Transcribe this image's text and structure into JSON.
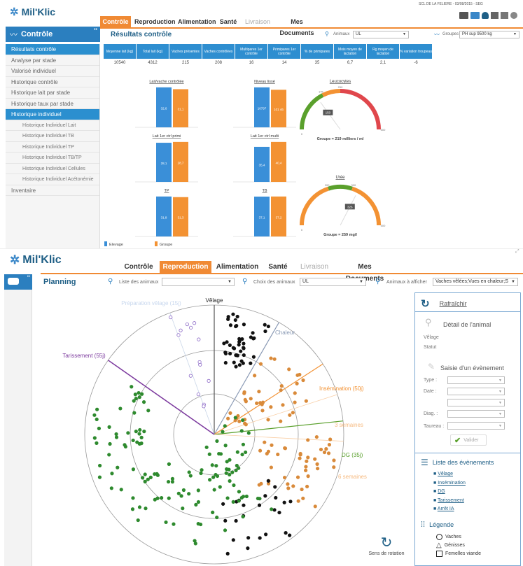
{
  "top": {
    "app_name": "Mil'Klic",
    "farm_info": "SCL DE LA FELIERE - 03/08/2015 - SEG",
    "tabs": [
      {
        "label": "Contrôle",
        "active": true
      },
      {
        "label": "Reproduction"
      },
      {
        "label": "Alimentation"
      },
      {
        "label": "Santé"
      },
      {
        "label": "Livraison",
        "disabled": true
      },
      {
        "label": "Mes Documents"
      }
    ],
    "sidebar_title": "Contrôle",
    "sidebar_items": [
      {
        "label": "Résultats contrôle",
        "active": true
      },
      {
        "label": "Analyse par stade"
      },
      {
        "label": "Valorisé individuel"
      },
      {
        "label": "Historique contrôle"
      },
      {
        "label": "Historique lait par stade"
      },
      {
        "label": "Historique taux par stade"
      },
      {
        "label": "Historique individuel",
        "active": true
      },
      {
        "label": "Historique Individuel Lait",
        "sub": true
      },
      {
        "label": "Historique Individuel TB",
        "sub": true
      },
      {
        "label": "Historique Individuel TP",
        "sub": true
      },
      {
        "label": "Historique Individuel TB/TP",
        "sub": true
      },
      {
        "label": "Historique Individuel Cellules",
        "sub": true
      },
      {
        "label": "Historique Individuel Acétonémie",
        "sub": true
      },
      {
        "label": "Inventaire"
      }
    ],
    "page_title": "Résultats contrôle",
    "animaux_label": "Animaux",
    "animaux_value": "UL",
    "groupes_label": "Groupes",
    "groupes_value": "PH sup 9500 kg",
    "kpi_headers": [
      "Moyenne lait (kg)",
      "Total lait (kg)",
      "Vaches présentes",
      "Vaches contrôlées",
      "Multipares 1er contrôle",
      "Primipares 1er contrôle",
      "% de primipares",
      "Mois moyen de lactation",
      "Rg moyen de lactation",
      "% variation troupeau"
    ],
    "kpi_values": [
      "10540",
      "4312",
      "215",
      "208",
      "16",
      "14",
      "35",
      "6,7",
      "2,1",
      "-6"
    ],
    "bar_charts": [
      {
        "title": "Lait/vache contrôlée",
        "values": [
          32.6,
          31.1
        ],
        "labels": [
          "32,6",
          "31,1"
        ]
      },
      {
        "title": "Niveau lissé",
        "values": [
          10797,
          10146
        ],
        "labels": [
          "10797",
          "101 46"
        ]
      },
      {
        "title": "Lait 1er ctrl primi",
        "values": [
          28.1,
          28.7
        ],
        "labels": [
          "28,1",
          "28,7"
        ]
      },
      {
        "title": "Lait 1er ctrl multi",
        "values": [
          35.4,
          40.4
        ],
        "labels": [
          "35,4",
          "40,4"
        ]
      },
      {
        "title": "TP",
        "values": [
          31.8,
          31.3
        ],
        "labels": [
          "31,8",
          "31,3"
        ]
      },
      {
        "title": "TB",
        "values": [
          37.1,
          37.2
        ],
        "labels": [
          "37,1",
          "37,2"
        ]
      }
    ],
    "gauges": [
      {
        "title": "Leucocytes",
        "value_label": "150",
        "ticks": [
          "175",
          "250",
          "500"
        ],
        "zero": "0",
        "caption": "Groupe = 219 milliers / ml",
        "value": 150,
        "min": 0,
        "max": 500
      },
      {
        "title": "Urée",
        "value_label": "326",
        "ticks": [
          "200",
          "300",
          "500"
        ],
        "zero": "0",
        "caption": "Groupe = 259 mg/l",
        "value": 326,
        "min": 0,
        "max": 500
      }
    ],
    "legend": [
      "Elevage",
      "Groupe"
    ],
    "colors": {
      "elevage": "#3a8fd8",
      "groupe": "#f39233"
    }
  },
  "bottom": {
    "app_name": "Mil'Klic",
    "tabs": [
      {
        "label": "Contrôle"
      },
      {
        "label": "Reproduction",
        "active": true
      },
      {
        "label": "Alimentation"
      },
      {
        "label": "Santé"
      },
      {
        "label": "Livraison",
        "disabled": true
      },
      {
        "label": "Mes Documents"
      }
    ],
    "page_title": "Planning",
    "liste_label": "Liste des animaux",
    "choix_label": "Choix des animaux",
    "choix_value": "UL",
    "afficher_label": "Animaux à afficher",
    "afficher_value": "Vaches vêlées;Vues en chaleur;S",
    "radar_labels": {
      "velage": "Vêlage",
      "prep": "Préparation vêlage (15j)",
      "chaleur": "Chaleur",
      "insem": "Insémination (50j)",
      "sem3": "3 semaines",
      "dg": "DG (35j)",
      "sem6": "6 semaines",
      "tarissement": "Tarissement (55j)"
    },
    "sens_rotation": "Sens de rotation",
    "right": {
      "refresh": "Rafraîchir",
      "detail_title": "Détail de l'animal",
      "velage": "Vêlage",
      "statut": "Statut",
      "saisie_title": "Saisie d'un évènement",
      "fields": [
        "Type :",
        "Date :",
        "Diag. :",
        "Taureau :"
      ],
      "valider": "Valider",
      "events_title": "Liste des évènements",
      "events": [
        "Vêlage",
        "Insémination",
        "DG",
        "Tarissement",
        "Arrêt IA"
      ],
      "legend_title": "Légende",
      "legend_items": [
        "Vaches",
        "Génisses",
        "Femelles viande"
      ]
    }
  }
}
